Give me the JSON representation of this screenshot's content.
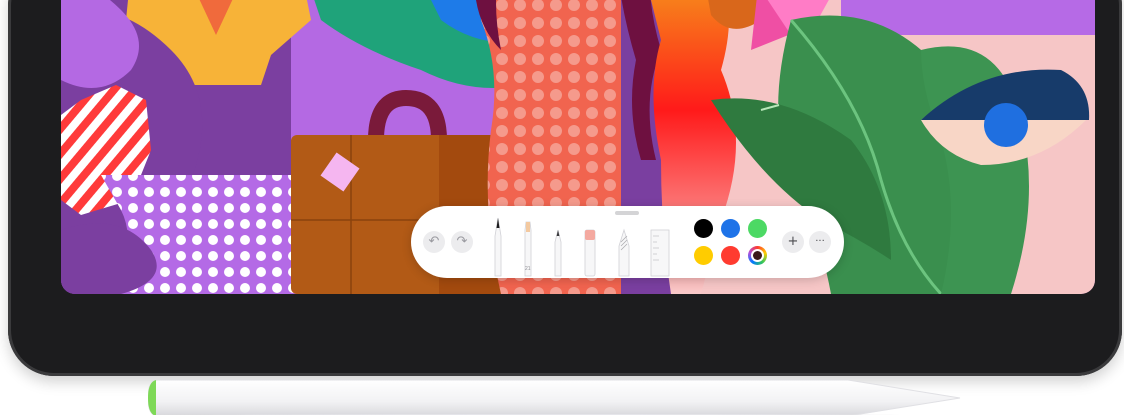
{
  "toolbar": {
    "undo_icon": "undo-icon",
    "redo_icon": "redo-icon",
    "add_glyph": "+",
    "more_glyph": "···",
    "tools": [
      {
        "name": "pen",
        "tip_color": "#1c1c1e"
      },
      {
        "name": "highlighter",
        "tip_color": "#f3c9a0",
        "label": "21"
      },
      {
        "name": "pencil",
        "tip_color": "#3a3a3c"
      },
      {
        "name": "eraser",
        "tip_color": "#f4a9a0"
      },
      {
        "name": "lasso",
        "tip_color": "#c7c7cc"
      },
      {
        "name": "ruler",
        "tip_color": "#e5e5ea"
      }
    ],
    "colors": [
      {
        "name": "black",
        "hex": "#000000"
      },
      {
        "name": "blue",
        "hex": "#1e73e8"
      },
      {
        "name": "green",
        "hex": "#4cd964"
      },
      {
        "name": "yellow",
        "hex": "#ffcc00"
      },
      {
        "name": "red",
        "hex": "#ff3b30"
      },
      {
        "name": "multicolor",
        "hex": "conic"
      }
    ],
    "selected_color": "black"
  },
  "colors": {
    "device_body": "#1c1c1e",
    "toolbar_bg": "#ffffff",
    "pencil_tip": "#7ed957"
  }
}
